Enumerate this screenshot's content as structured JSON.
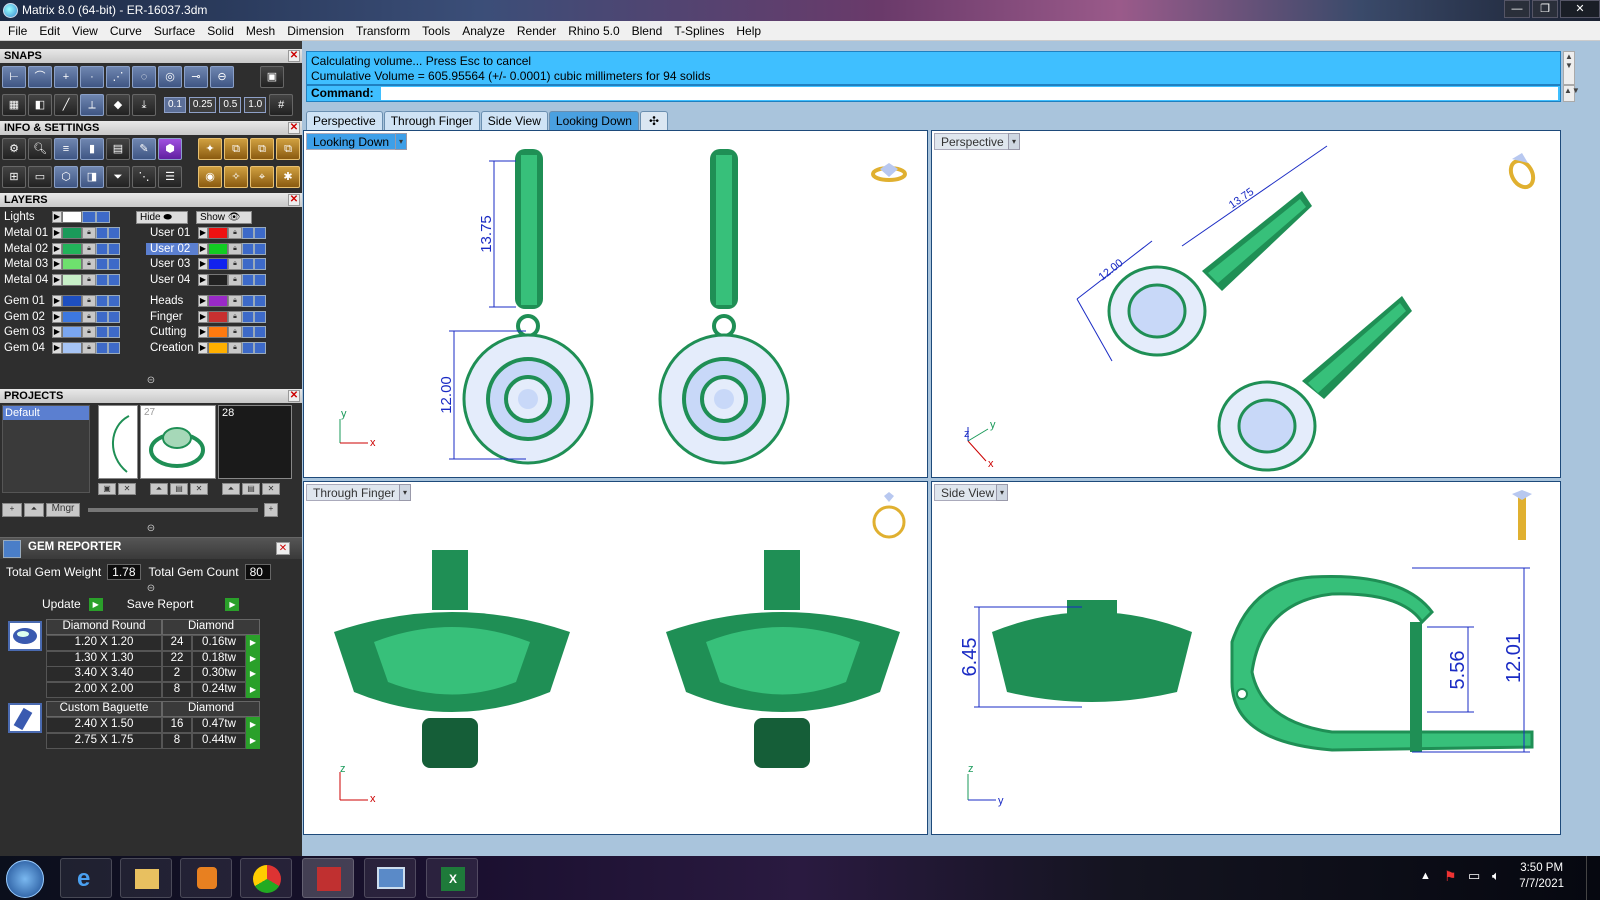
{
  "window": {
    "title": "Matrix 8.0 (64-bit) - ER-16037.3dm",
    "controls": {
      "minimize": "—",
      "restore": "❐",
      "close": "✕"
    }
  },
  "menu": [
    "File",
    "Edit",
    "View",
    "Curve",
    "Surface",
    "Solid",
    "Mesh",
    "Dimension",
    "Transform",
    "Tools",
    "Analyze",
    "Render",
    "Rhino 5.0",
    "Blend",
    "T-Splines",
    "Help"
  ],
  "snaps": {
    "title": "SNAPS",
    "steps": [
      "0.1",
      "0.25",
      "0.5",
      "1.0"
    ]
  },
  "info_settings": {
    "title": "INFO & SETTINGS"
  },
  "layers": {
    "title": "LAYERS",
    "lights_label": "Lights",
    "hide_label": "Hide",
    "show_label": "Show",
    "left": [
      {
        "name": "Metal 01",
        "color": "#1a9a5a"
      },
      {
        "name": "Metal 02",
        "color": "#22b35a"
      },
      {
        "name": "Metal 03",
        "color": "#6ee06e"
      },
      {
        "name": "Metal 04",
        "color": "#c8f0c8"
      },
      {
        "name": "Gem 01",
        "color": "#1e4fc0"
      },
      {
        "name": "Gem 02",
        "color": "#3d78e0"
      },
      {
        "name": "Gem 03",
        "color": "#7aa6f0"
      },
      {
        "name": "Gem 04",
        "color": "#a6c4f4"
      }
    ],
    "right": [
      {
        "name": "User 01",
        "color": "#ee1111"
      },
      {
        "name": "User 02",
        "color": "#11cc22",
        "selected": true
      },
      {
        "name": "User 03",
        "color": "#1122ee"
      },
      {
        "name": "User 04",
        "color": "#222222"
      },
      {
        "name": "Heads",
        "color": "#9a2ac8"
      },
      {
        "name": "Finger",
        "color": "#c83030"
      },
      {
        "name": "Cutting",
        "color": "#ff7a10"
      },
      {
        "name": "Creation",
        "color": "#ffb000"
      }
    ]
  },
  "projects": {
    "title": "PROJECTS",
    "selected": "Default",
    "thumbs": [
      "27",
      "28"
    ],
    "mngr_label": "Mngr"
  },
  "gem_reporter": {
    "title": "GEM REPORTER",
    "total_weight_label": "Total Gem Weight",
    "total_weight": "1.78",
    "total_count_label": "Total Gem Count",
    "total_count": "80",
    "update_label": "Update",
    "save_label": "Save Report",
    "groups": [
      {
        "shape": "Diamond Round",
        "material": "Diamond",
        "rows": [
          {
            "size": "1.20 X 1.20",
            "count": "24",
            "weight": "0.16tw"
          },
          {
            "size": "1.30 X 1.30",
            "count": "22",
            "weight": "0.18tw"
          },
          {
            "size": "3.40 X 3.40",
            "count": "2",
            "weight": "0.30tw"
          },
          {
            "size": "2.00 X 2.00",
            "count": "8",
            "weight": "0.24tw"
          }
        ]
      },
      {
        "shape": "Custom Baguette",
        "material": "Diamond",
        "rows": [
          {
            "size": "2.40 X 1.50",
            "count": "16",
            "weight": "0.47tw"
          },
          {
            "size": "2.75 X 1.75",
            "count": "8",
            "weight": "0.44tw"
          }
        ]
      }
    ]
  },
  "command": {
    "line1": "Calculating volume... Press Esc to cancel",
    "line2": "Cumulative Volume = 605.95564 (+/- 0.0001) cubic millimeters for 94 solids",
    "prompt": "Command:"
  },
  "tabs": [
    {
      "label": "Perspective",
      "active": false
    },
    {
      "label": "Through Finger",
      "active": false
    },
    {
      "label": "Side View",
      "active": false
    },
    {
      "label": "Looking Down",
      "active": true
    }
  ],
  "viewports": {
    "top_left": {
      "label": "Looking Down",
      "dim_a": "13.75",
      "dim_b": "12.00",
      "axis_x": "x",
      "axis_y": "y"
    },
    "top_right": {
      "label": "Perspective",
      "dim_a": "13.75",
      "dim_b": "12.00",
      "axis_x": "x",
      "axis_y": "y",
      "axis_z": "z"
    },
    "bottom_left": {
      "label": "Through Finger",
      "axis_x": "x",
      "axis_z": "z"
    },
    "bottom_right": {
      "label": "Side View",
      "dim_a": "6.45",
      "dim_b": "5.56",
      "dim_c": "12.01",
      "axis_y": "y",
      "axis_z": "z"
    }
  },
  "taskbar": {
    "time": "3:50 PM",
    "date": "7/7/2021"
  },
  "colors": {
    "metal": "#1f8f55",
    "metal_light": "#37c07a",
    "gem": "#c8d8f8",
    "dimension": "#1a2bc4",
    "command_bg": "#3fbfff"
  }
}
